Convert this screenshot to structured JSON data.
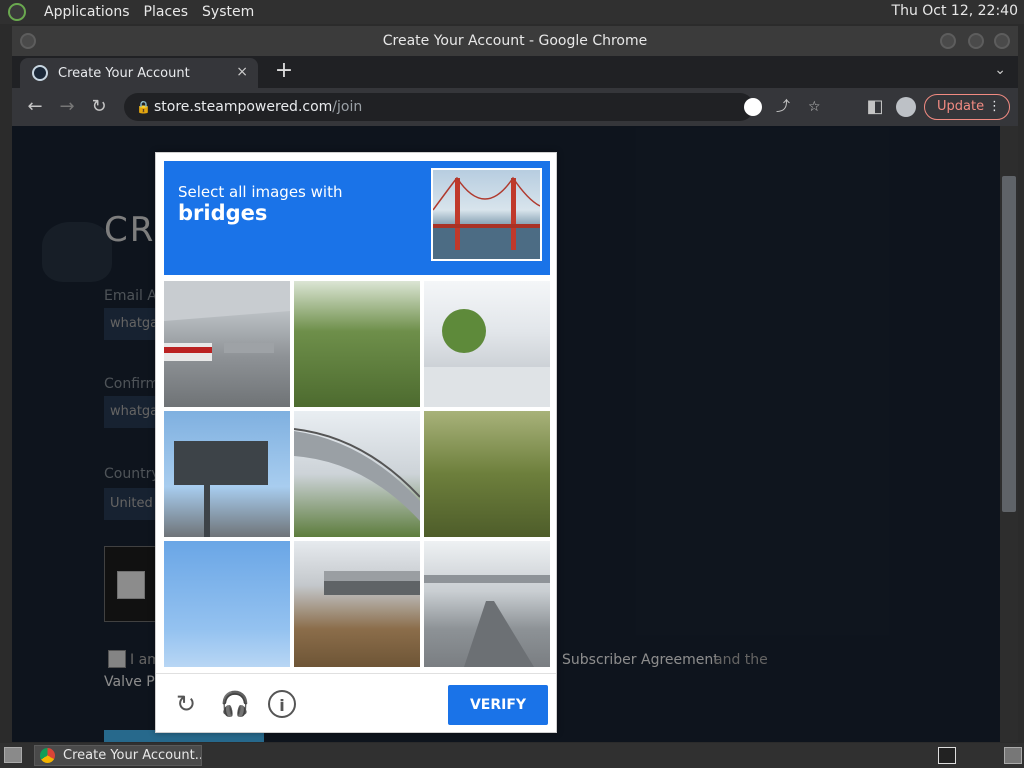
{
  "top_panel": {
    "menus": [
      "Applications",
      "Places",
      "System"
    ],
    "clock": "Thu Oct 12, 22:40"
  },
  "window": {
    "title": "Create Your Account - Google Chrome"
  },
  "tab": {
    "label": "Create Your Account",
    "close": "×",
    "new_tab": "+"
  },
  "toolbar": {
    "url_domain": "store.steampowered.com",
    "url_path": "/join",
    "update_label": "Update"
  },
  "steam_page": {
    "title_fragment": "CRI",
    "email_label": "Email Ac",
    "email_value": "whatga",
    "confirm_label": "Confirm",
    "confirm_value": "whatga",
    "country_label": "Country",
    "country_value": "United",
    "agree_prefix": "I am",
    "subscriber_agreement": "Subscriber Agreement",
    "and_the": "and the",
    "valve_fragment": "Valve Pr"
  },
  "captcha": {
    "instruction": "Select all images with",
    "target": "bridges",
    "verify_label": "VERIFY",
    "accent": "#1a73e8"
  },
  "taskbar": {
    "item_label": "Create Your Account..."
  }
}
